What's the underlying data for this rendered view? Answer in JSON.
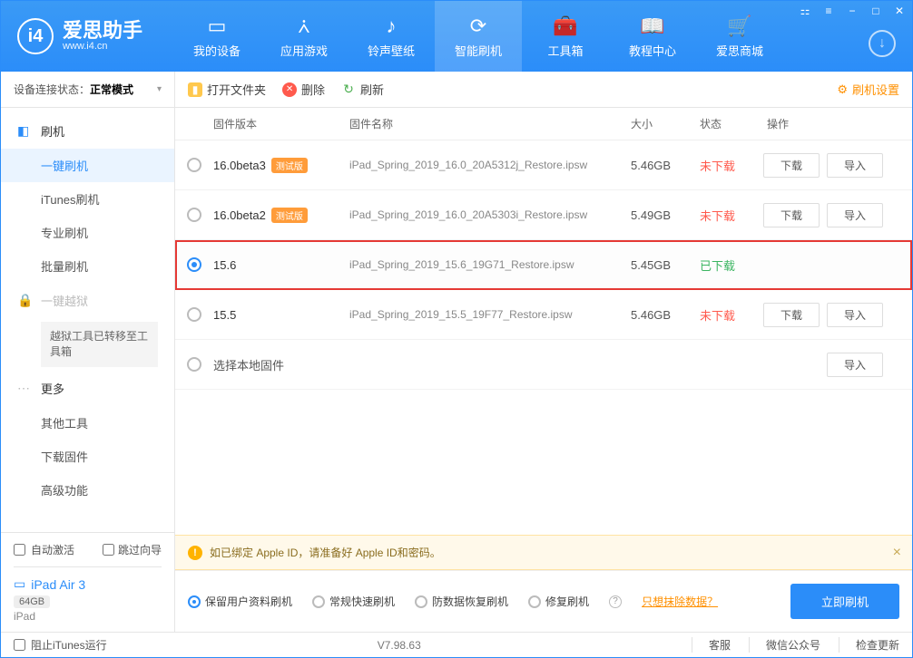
{
  "app": {
    "name": "爱思助手",
    "url": "www.i4.cn"
  },
  "nav": {
    "items": [
      {
        "label": "我的设备"
      },
      {
        "label": "应用游戏"
      },
      {
        "label": "铃声壁纸"
      },
      {
        "label": "智能刷机"
      },
      {
        "label": "工具箱"
      },
      {
        "label": "教程中心"
      },
      {
        "label": "爱思商城"
      }
    ]
  },
  "device_status": {
    "label": "设备连接状态：",
    "value": "正常模式"
  },
  "sidebar": {
    "groups": [
      {
        "label": "刷机",
        "items": [
          "一键刷机",
          "iTunes刷机",
          "专业刷机",
          "批量刷机"
        ]
      },
      {
        "label": "一键越狱",
        "note": "越狱工具已转移至工具箱"
      },
      {
        "label": "更多",
        "items": [
          "其他工具",
          "下载固件",
          "高级功能"
        ]
      }
    ]
  },
  "side_footer": {
    "auto_activate": "自动激活",
    "skip_guide": "跳过向导"
  },
  "device": {
    "name": "iPad Air 3",
    "capacity": "64GB",
    "type": "iPad"
  },
  "toolbar": {
    "open_folder": "打开文件夹",
    "delete": "删除",
    "refresh": "刷新",
    "settings": "刷机设置"
  },
  "table": {
    "headers": {
      "version": "固件版本",
      "name": "固件名称",
      "size": "大小",
      "status": "状态",
      "ops": "操作"
    },
    "download_label": "下载",
    "import_label": "导入",
    "rows": [
      {
        "version": "16.0beta3",
        "beta": "测试版",
        "name": "iPad_Spring_2019_16.0_20A5312j_Restore.ipsw",
        "size": "5.46GB",
        "status": "未下载",
        "status_class": "pending",
        "ops": true
      },
      {
        "version": "16.0beta2",
        "beta": "测试版",
        "name": "iPad_Spring_2019_16.0_20A5303i_Restore.ipsw",
        "size": "5.49GB",
        "status": "未下载",
        "status_class": "pending",
        "ops": true
      },
      {
        "version": "15.6",
        "name": "iPad_Spring_2019_15.6_19G71_Restore.ipsw",
        "size": "5.45GB",
        "status": "已下载",
        "status_class": "done",
        "selected": true,
        "highlight": true
      },
      {
        "version": "15.5",
        "name": "iPad_Spring_2019_15.5_19F77_Restore.ipsw",
        "size": "5.46GB",
        "status": "未下载",
        "status_class": "pending",
        "ops": true
      }
    ],
    "local_row": "选择本地固件"
  },
  "notice": "如已绑定 Apple ID，请准备好 Apple ID和密码。",
  "flash_opts": {
    "opts": [
      "保留用户资料刷机",
      "常规快速刷机",
      "防数据恢复刷机",
      "修复刷机"
    ],
    "link": "只想抹除数据？",
    "action": "立即刷机"
  },
  "statusbar": {
    "block_itunes": "阻止iTunes运行",
    "version": "V7.98.63",
    "right": [
      "客服",
      "微信公众号",
      "检查更新"
    ]
  }
}
